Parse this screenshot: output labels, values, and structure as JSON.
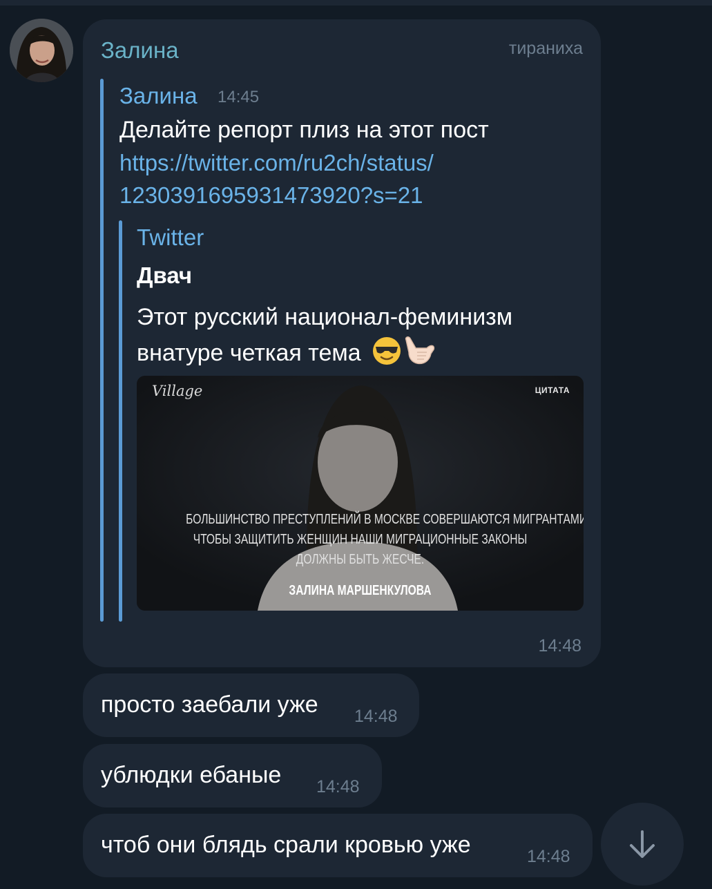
{
  "chat": {
    "sender_name": "Залина",
    "admin_title": "тираниха"
  },
  "forwarded": {
    "author": "Залина",
    "time": "14:45",
    "text": "Делайте репорт плиз на этот пост",
    "link_line1": "https://twitter.com/ru2ch/status/",
    "link_line2": "1230391695931473920?s=21"
  },
  "link_preview": {
    "site_name": "Twitter",
    "title": "Двач",
    "description_line1": "Этот русский национал-феминизм",
    "description_line2": "внатуре четкая тема",
    "emojis": [
      "smiling-face-with-sunglasses",
      "call-me-hand"
    ],
    "image": {
      "logo": "Village",
      "tag": "ЦИТАТА",
      "quote_lines": [
        "БОЛЬШИНСТВО ПРЕСТУПЛЕНИЙ В МОСКВЕ СОВЕРШАЮТСЯ МИГРАНТАМИ.",
        "ЧТОБЫ ЗАЩИТИТЬ ЖЕНЩИН НАШИ МИГРАЦИОННЫЕ ЗАКОНЫ",
        "ДОЛЖНЫ БЫТЬ ЖЕСЧЕ."
      ],
      "author": "ЗАЛИНА МАРШЕНКУЛОВА"
    }
  },
  "main_message_time": "14:48",
  "messages": [
    {
      "text": "просто заебали уже",
      "time": "14:48"
    },
    {
      "text": "ублюдки ебаные",
      "time": "14:48"
    },
    {
      "text": "чтоб они блядь срали кровью уже",
      "time": "14:48"
    }
  ],
  "icons": {
    "scroll_down": "arrow-down-icon"
  },
  "colors": {
    "background": "#121b25",
    "bubble": "#1d2734",
    "sender_name": "#6ab3c8",
    "link": "#6ab3e8",
    "timestamp": "#6d7e8f",
    "accent_bar": "#5b9bd5"
  }
}
